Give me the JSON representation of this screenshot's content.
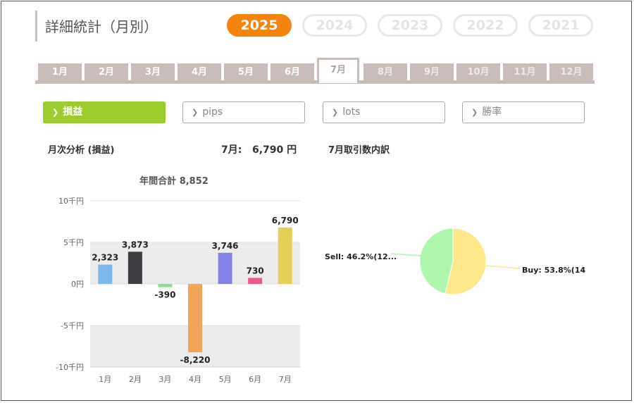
{
  "header": {
    "title": "詳細統計（月別）"
  },
  "years": [
    "2025",
    "2024",
    "2023",
    "2022",
    "2021"
  ],
  "months": [
    "1月",
    "2月",
    "3月",
    "4月",
    "5月",
    "6月",
    "7月",
    "8月",
    "9月",
    "10月",
    "11月",
    "12月"
  ],
  "metrics": [
    "損益",
    "pips",
    "lots",
    "勝率"
  ],
  "summary": {
    "left_title": "月次分析 (損益)",
    "month_value_label": "7月:",
    "month_value": "6,790 円",
    "right_title": "7月取引数内訳"
  },
  "chart_data": [
    {
      "type": "bar",
      "title": "年間合計 8,852",
      "categories": [
        "1月",
        "2月",
        "3月",
        "4月",
        "5月",
        "6月",
        "7月"
      ],
      "values": [
        2323,
        3873,
        -390,
        -8220,
        3746,
        730,
        6790
      ],
      "value_labels": [
        "2,323",
        "3,873",
        "-390",
        "-8,220",
        "3,746",
        "730",
        "6,790"
      ],
      "colors": [
        "#7eb7ea",
        "#3d3d42",
        "#8be08e",
        "#f4a35a",
        "#8583e6",
        "#e85c86",
        "#e4cf57"
      ],
      "yticks": [
        "10千円",
        "5千円",
        "0円",
        "-5千円",
        "-10千円"
      ],
      "ytick_values": [
        10000,
        5000,
        0,
        -5000,
        -10000
      ],
      "ylim": [
        -10000,
        10000
      ]
    },
    {
      "type": "pie",
      "labels": [
        "Sell: 46.2%(12...",
        "Buy: 53.8%(14"
      ],
      "values": [
        46.2,
        53.8
      ],
      "colors": [
        "#aef7ad",
        "#fde88c"
      ]
    }
  ]
}
